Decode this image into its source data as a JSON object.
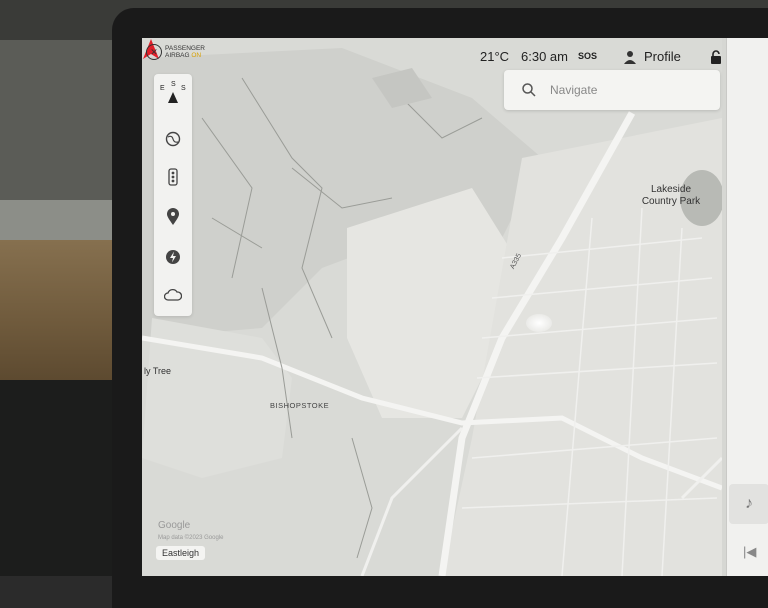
{
  "status_bar": {
    "airbag_line1": "PASSENGER",
    "airbag_line2": "AIRBAG",
    "airbag_state": "ON",
    "temperature": "21°C",
    "time": "6:30 am",
    "sos": "SOS",
    "profile_label": "Profile"
  },
  "search": {
    "placeholder": "Navigate"
  },
  "compass": {
    "left": "E",
    "top": "S",
    "right": "S"
  },
  "controls": [
    "globe-icon",
    "traffic-light-icon",
    "location-pin-icon",
    "charging-bolt-icon",
    "weather-cloud-icon"
  ],
  "map": {
    "labels": {
      "lakeside_line1": "Lakeside",
      "lakeside_line2": "Country Park",
      "bishopstoke": "BISHOPSTOKE",
      "tree": "ly Tree",
      "road": "A335",
      "google": "Google",
      "map_data": "Map data ©2023 Google"
    },
    "place_button": "Eastleigh"
  },
  "right_panel": {
    "music_icon": "♪",
    "prev_icon": "|◀"
  },
  "colors": {
    "car_marker": "#e0202a",
    "airbag_on": "#d8a000",
    "map_bg": "#d6d7d3"
  }
}
